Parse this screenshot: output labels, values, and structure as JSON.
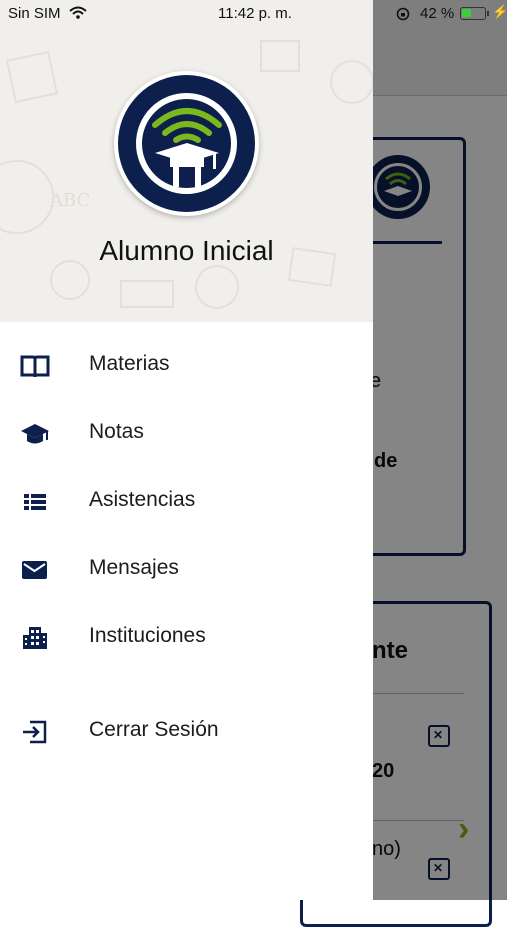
{
  "status_bar": {
    "carrier": "Sin SIM",
    "time": "11:42 p. m.",
    "battery_percent_label": "42 %",
    "battery_level": 0.42
  },
  "drawer": {
    "profile_name": "Alumno Inicial",
    "menu": [
      {
        "label": "Materias",
        "icon": "book-icon"
      },
      {
        "label": "Notas",
        "icon": "graduation-cap-icon"
      },
      {
        "label": "Asistencias",
        "icon": "list-icon"
      },
      {
        "label": "Mensajes",
        "icon": "mail-icon"
      },
      {
        "label": "Instituciones",
        "icon": "building-icon"
      },
      {
        "label": "Cerrar Sesión",
        "icon": "logout-icon"
      }
    ]
  },
  "background": {
    "fragment_1": "e",
    "fragment_2": "de",
    "fragment_3": "nte",
    "fragment_4": "20",
    "fragment_5": "no)"
  },
  "colors": {
    "brand_navy": "#0d1f4d",
    "brand_green": "#7ab81e"
  }
}
